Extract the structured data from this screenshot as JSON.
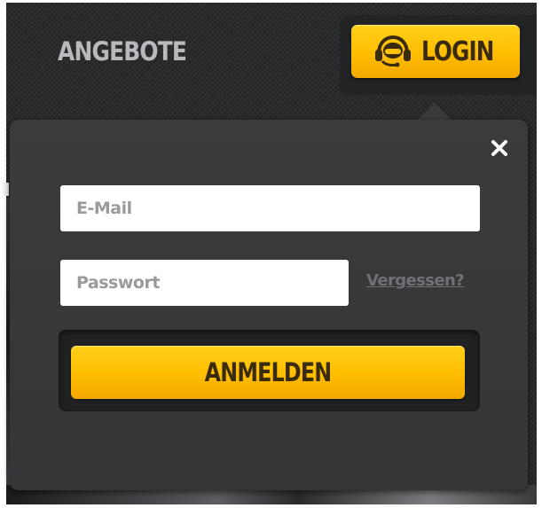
{
  "header": {
    "nav_label": "ANGEBOTE",
    "login_label": "LOGIN",
    "login_icon": "headset-user-icon"
  },
  "login_panel": {
    "close_icon": "close-icon",
    "email_placeholder": "E-Mail",
    "email_value": "",
    "password_placeholder": "Passwort",
    "password_value": "",
    "forgot_label": "Vergessen?",
    "submit_label": "ANMELDEN"
  },
  "colors": {
    "accent": "#ffbd00",
    "button_text": "#3b2b0d",
    "background": "#2b2c2e",
    "panel": "#3a3b3d",
    "nav_text": "#b7b9bd",
    "link_text": "#6f7176"
  }
}
